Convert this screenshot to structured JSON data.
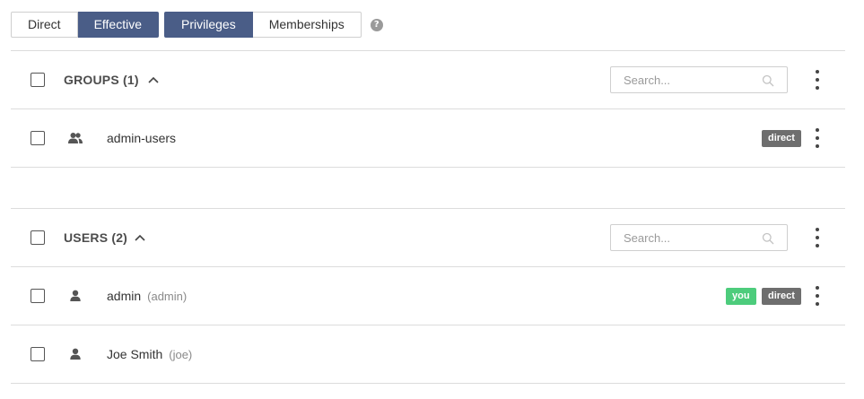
{
  "view_toggle": {
    "direct": "Direct",
    "effective": "Effective",
    "privileges": "Privileges",
    "memberships": "Memberships",
    "help": "?",
    "active_color": "#4a5d87"
  },
  "groups": {
    "title": "GROUPS",
    "count": "(1)",
    "search_placeholder": "Search...",
    "items": [
      {
        "name": "admin-users",
        "badge": "direct"
      }
    ]
  },
  "users": {
    "title": "USERS",
    "count": "(2)",
    "search_placeholder": "Search...",
    "items": [
      {
        "name": "admin",
        "login": "(admin)",
        "badge_you": "you",
        "badge": "direct"
      },
      {
        "name": "Joe Smith",
        "login": "(joe)"
      }
    ]
  },
  "colors": {
    "badge_direct": "#6e6e6e",
    "badge_you": "#4dcc7c"
  }
}
